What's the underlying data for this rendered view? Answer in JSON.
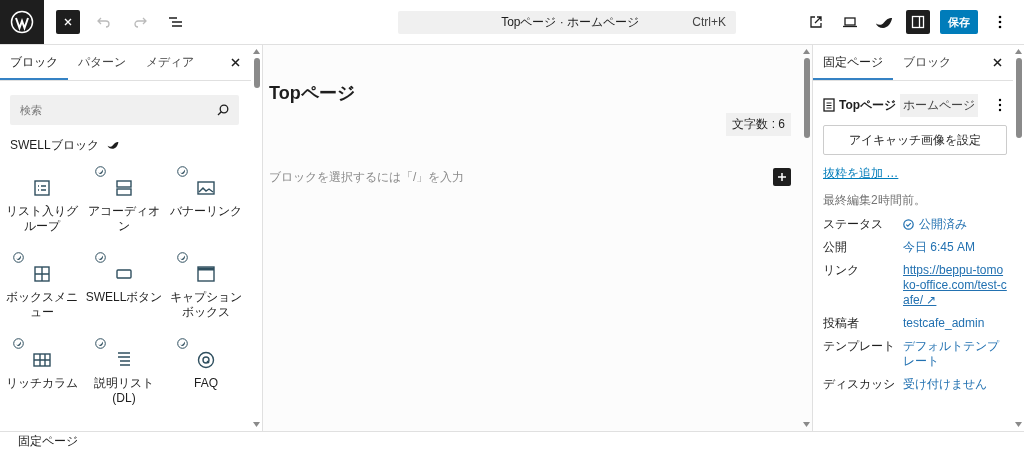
{
  "topbar": {
    "command_title": "Topページ · ホームページ",
    "shortcut": "Ctrl+K",
    "save_label": "保存",
    "settings_panel_open": true
  },
  "inserter": {
    "tabs": [
      {
        "label": "ブロック",
        "selected": true
      },
      {
        "label": "パターン",
        "selected": false
      },
      {
        "label": "メディア",
        "selected": false
      }
    ],
    "search": {
      "placeholder": "検索"
    },
    "category": "SWELLブロック",
    "blocks": [
      {
        "label": "リスト入りグループ",
        "kind": "list",
        "badge": false
      },
      {
        "label": "アコーディオン",
        "kind": "accordion",
        "badge": true
      },
      {
        "label": "バナーリンク",
        "kind": "image",
        "badge": true
      },
      {
        "label": "ボックスメニュー",
        "kind": "grid",
        "badge": true
      },
      {
        "label": "SWELLボタン",
        "kind": "button",
        "badge": true
      },
      {
        "label": "キャプションボックス",
        "kind": "window",
        "badge": true
      },
      {
        "label": "リッチカラム",
        "kind": "columns",
        "badge": true
      },
      {
        "label": "説明リスト(DL)",
        "kind": "dl",
        "badge": true
      },
      {
        "label": "FAQ",
        "kind": "faq",
        "badge": true
      }
    ]
  },
  "canvas": {
    "title": "Topページ",
    "char_count": "文字数 : 6",
    "placeholder": "ブロックを選択するには「/」を入力"
  },
  "settings": {
    "tabs": [
      {
        "label": "固定ページ",
        "selected": true
      },
      {
        "label": "ブロック",
        "selected": false
      }
    ],
    "page_title": "Topページ",
    "page_badge": "ホームページ",
    "featured_button": "アイキャッチ画像を設定",
    "excerpt_link": "抜粋を追加 …",
    "last_edited": "最終編集2時間前。",
    "rows": [
      {
        "label": "ステータス",
        "value": "公開済み",
        "kind": "status"
      },
      {
        "label": "公開",
        "value": "今日 6:45 AM",
        "kind": "text"
      },
      {
        "label": "リンク",
        "value": "https://beppu-tomoko-office.com/test-cafe/ ↗",
        "kind": "link"
      },
      {
        "label": "投稿者",
        "value": "testcafe_admin",
        "kind": "text"
      },
      {
        "label": "テンプレート",
        "value": "デフォルトテンプレート",
        "kind": "text"
      },
      {
        "label": "ディスカッシ",
        "value": "受け付けません",
        "kind": "text"
      }
    ]
  },
  "footer": {
    "breadcrumb": "固定ページ"
  }
}
